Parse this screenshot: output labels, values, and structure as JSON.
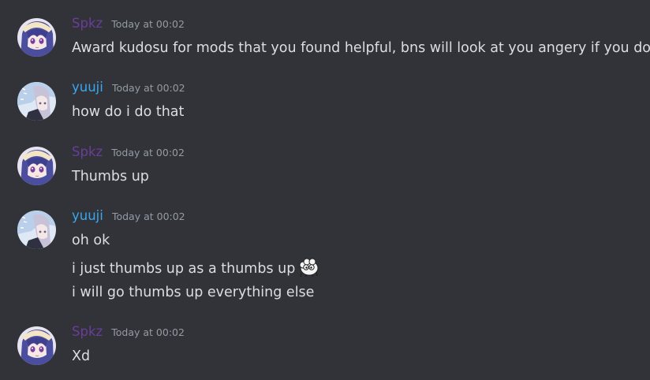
{
  "colors": {
    "background": "#313338",
    "text": "#dbdee1",
    "timestamp": "#949ba4",
    "spkz_name": "#6a3d9a",
    "yuuji_name": "#3aa7ee"
  },
  "messages": [
    {
      "author": "Spkz",
      "avatar": "spkz-avatar",
      "timestamp": "Today at 00:02",
      "lines": [
        "Award kudosu for mods that you found helpful, bns will look at you angery if you dont"
      ]
    },
    {
      "author": "yuuji",
      "avatar": "yuuji-avatar",
      "timestamp": "Today at 00:02",
      "lines": [
        "how do i do that"
      ]
    },
    {
      "author": "Spkz",
      "avatar": "spkz-avatar",
      "timestamp": "Today at 00:02",
      "lines": [
        "Thumbs up"
      ]
    },
    {
      "author": "yuuji",
      "avatar": "yuuji-avatar",
      "timestamp": "Today at 00:02",
      "lines": [
        "oh ok",
        "i just thumbs up as a thumbs up",
        "i will go thumbs up everything else"
      ],
      "emoji_after_line_2": "sheep-emoji"
    },
    {
      "author": "Spkz",
      "avatar": "spkz-avatar",
      "timestamp": "Today at 00:02",
      "lines": [
        "Xd"
      ]
    }
  ]
}
